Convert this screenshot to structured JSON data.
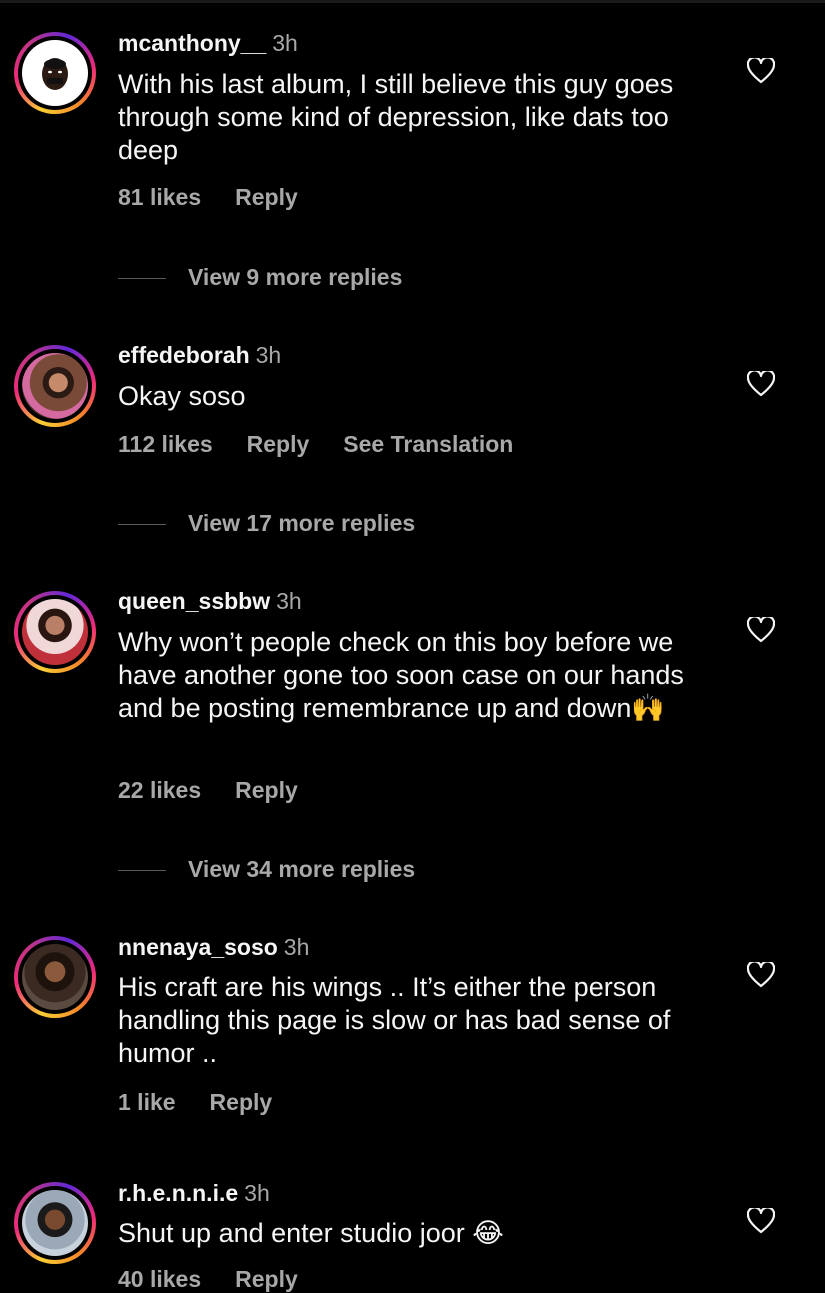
{
  "comments": [
    {
      "username": "mcanthony__",
      "time": "3h",
      "text": "With his last album, I still believe this guy goes through some kind of depression, like dats too deep",
      "likes": "81 likes",
      "reply": "Reply",
      "view_replies": "View 9 more replies",
      "avatar": "profile-avatar"
    },
    {
      "username": "effedeborah",
      "time": "3h",
      "text": "Okay soso",
      "likes": "112 likes",
      "reply": "Reply",
      "translation": "See Translation",
      "view_replies": "View 17 more replies",
      "avatar": "profile-avatar"
    },
    {
      "username": "queen_ssbbw",
      "time": "3h",
      "text": "Why won’t people check on this boy before we have another gone too soon case on our hands and be posting remembrance up and down🙌",
      "likes": "22 likes",
      "reply": "Reply",
      "view_replies": "View 34 more replies",
      "avatar": "profile-avatar"
    },
    {
      "username": "nnenaya_soso",
      "time": "3h",
      "text": "His craft are his wings .. It’s either the person handling this page is slow or has bad sense of humor ..",
      "likes": "1 like",
      "reply": "Reply",
      "avatar": "profile-avatar"
    },
    {
      "username": "r.h.e.n.n.i.e",
      "time": "3h",
      "text": "Shut up and enter studio joor 😂",
      "likes": "40 likes",
      "reply": "Reply",
      "avatar": "profile-avatar"
    }
  ],
  "icons": {
    "like": "heart-outline-icon"
  },
  "colors": {
    "background": "#000000",
    "primary_text": "#f5f5f5",
    "secondary_text": "#a8a8a8"
  }
}
